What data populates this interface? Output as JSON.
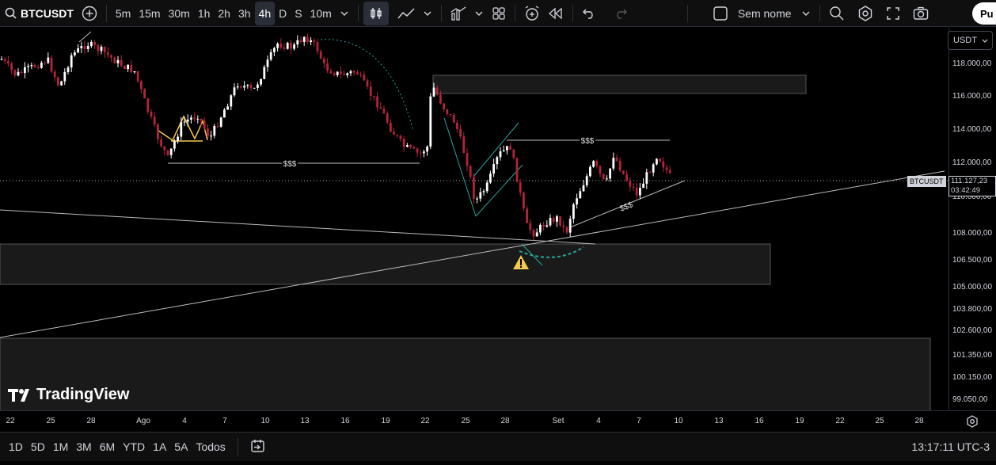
{
  "toolbar": {
    "symbol": "BTCUSDT",
    "intervals": [
      "5m",
      "15m",
      "30m",
      "1h",
      "2h",
      "3h",
      "4h",
      "D",
      "S",
      "10m"
    ],
    "active_interval": "4h",
    "layout_name": "Sem nome",
    "publish_label": "Pu"
  },
  "currency": "USDT",
  "current_price": {
    "symbol_tag": "BTCUSDT",
    "price": "111.127,23",
    "countdown": "03:42:49"
  },
  "price_axis": [
    "118.000,00",
    "116.000,00",
    "114.000,00",
    "112.000,00",
    "110.000,00",
    "108.000,00",
    "106.500,00",
    "105.000,00",
    "103.800,00",
    "102.600,00",
    "101.350,00",
    "100.150,00",
    "99.050,00"
  ],
  "time_axis": [
    "22",
    "25",
    "28",
    "Ago",
    "4",
    "7",
    "10",
    "13",
    "16",
    "19",
    "22",
    "25",
    "28",
    "Set",
    "4",
    "7",
    "10",
    "13",
    "16",
    "19",
    "22",
    "25",
    "28"
  ],
  "annotations": {
    "liquidity_label": "$$$"
  },
  "logo_text": "TradingView",
  "bottom": {
    "ranges": [
      "1D",
      "5D",
      "1M",
      "3M",
      "6M",
      "YTD",
      "1A",
      "5A",
      "Todos"
    ],
    "clock": "13:17:11 UTC-3"
  },
  "colors": {
    "bull": "#ffffff",
    "bear": "#b2243a",
    "teal": "#26a69a",
    "yellow": "#f2c94c"
  }
}
